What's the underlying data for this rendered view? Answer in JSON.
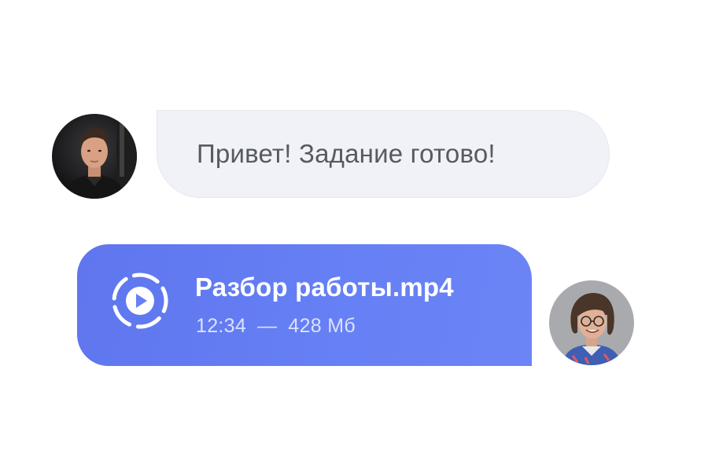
{
  "chat": {
    "incoming": {
      "avatar_icon": "young-man-portrait",
      "text": "Привет! Задание готово!"
    },
    "outgoing": {
      "avatar_icon": "person-with-glasses-portrait",
      "attachment": {
        "icon": "play-video-icon",
        "file_name": "Разбор работы.mp4",
        "duration": "12:34",
        "separator": "—",
        "size": "428 Мб"
      }
    }
  },
  "colors": {
    "incoming_bubble": "#f1f2f7",
    "incoming_text": "#555a63",
    "outgoing_bubble": "#6680f5",
    "outgoing_text": "#ffffff",
    "outgoing_meta": "#dbe2ff"
  }
}
